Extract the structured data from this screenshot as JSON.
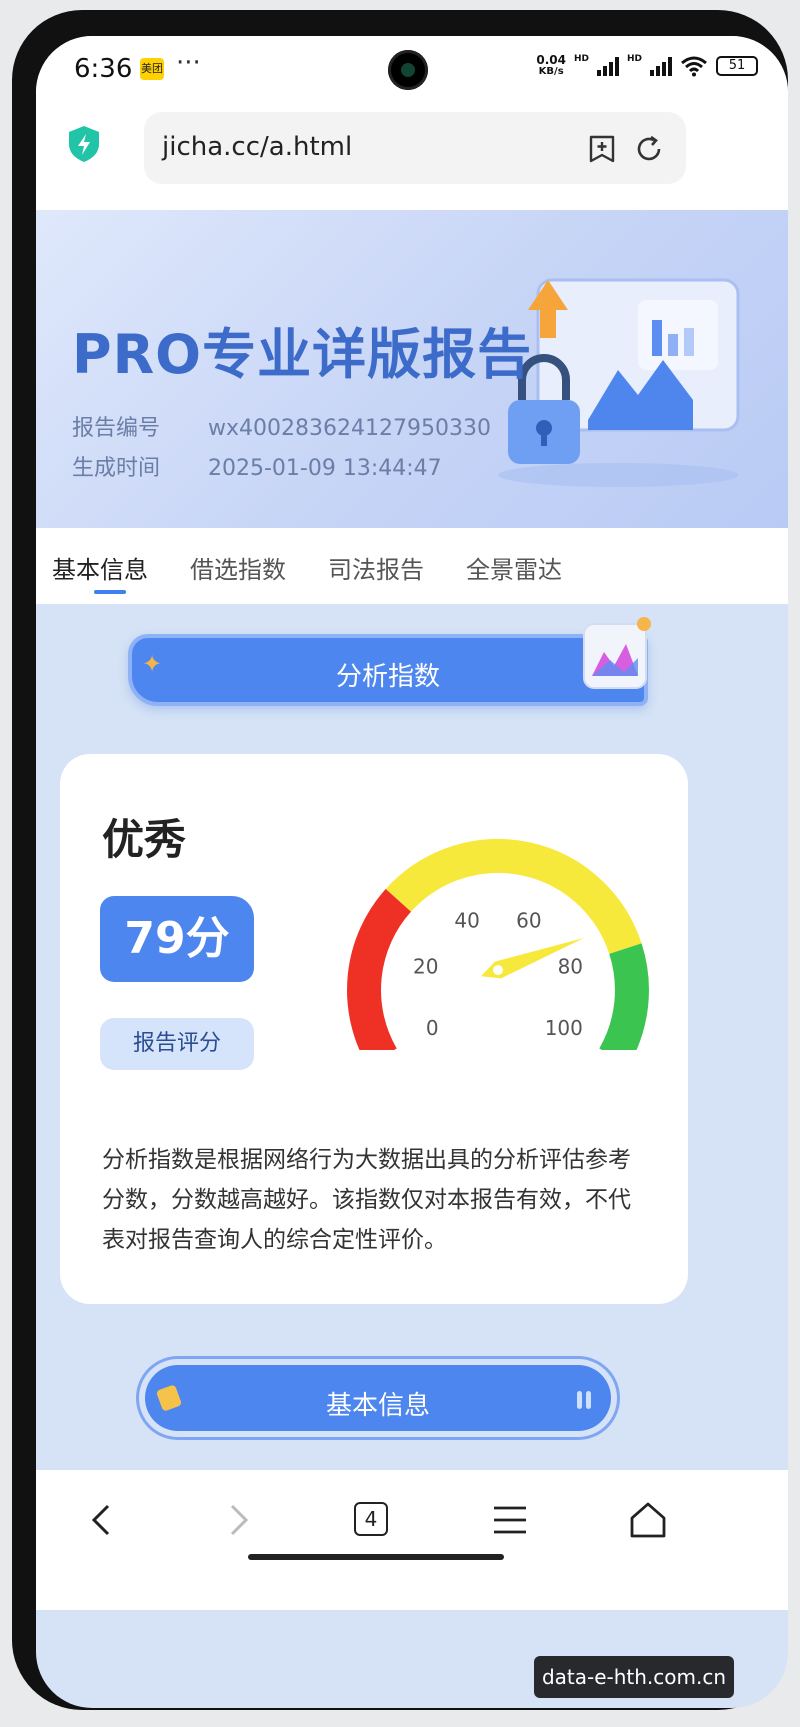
{
  "status_bar": {
    "time": "6:36",
    "app_badge": "美团",
    "more": "···",
    "net_speed_value": "0.04",
    "net_speed_unit": "KB/s",
    "signal_1_label": "HD",
    "signal_2_label": "HD",
    "battery": "51"
  },
  "browser": {
    "url": "jicha.cc/a.html",
    "tab_count": "4"
  },
  "banner": {
    "title": "PRO专业详版报告",
    "report_no_label": "报告编号",
    "report_no_value": "wx400283624127950330",
    "time_label": "生成时间",
    "time_value": "2025-01-09 13:44:47"
  },
  "tabs": [
    {
      "label": "基本信息"
    },
    {
      "label": "借选指数"
    },
    {
      "label": "司法报告"
    },
    {
      "label": "全景雷达"
    }
  ],
  "analysis": {
    "section_title": "分析指数",
    "grade": "优秀",
    "score": "79分",
    "score_value": 79,
    "score_label": "报告评分",
    "gauge_ticks": [
      "0",
      "20",
      "40",
      "60",
      "80",
      "100"
    ],
    "gauge_colors": {
      "low": "#ee3124",
      "mid": "#f7e93c",
      "high": "#3cc450"
    },
    "description": "分析指数是根据网络行为大数据出具的分析评估参考分数，分数越高越好。该指数仅对本报告有效，不代表对报告查询人的综合定性评价。"
  },
  "section2": {
    "title": "基本信息"
  },
  "watermark": "data-e-hth.com.cn"
}
